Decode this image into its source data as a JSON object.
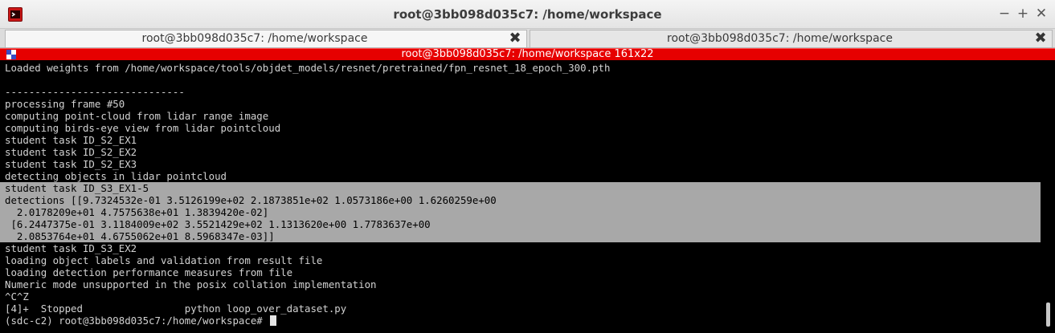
{
  "window": {
    "title": "root@3bb098d035c7: /home/workspace",
    "controls": {
      "minimize": "−",
      "maximize": "+",
      "close": "✕"
    },
    "icon": "terminator-icon"
  },
  "tabs": [
    {
      "label": "root@3bb098d035c7: /home/workspace",
      "close": "✖",
      "active": true
    },
    {
      "label": "root@3bb098d035c7: /home/workspace",
      "close": "✖",
      "active": false
    }
  ],
  "terminal": {
    "header": "root@3bb098d035c7: /home/workspace 161x22",
    "colors": {
      "header_bg": "#e60000",
      "selection_bg": "#a8a8a8",
      "text": "#d2d2d2",
      "background": "#000000"
    },
    "lines": [
      {
        "text": "Loaded weights from /home/workspace/tools/objdet_models/resnet/pretrained/fpn_resnet_18_epoch_300.pth",
        "selected": false
      },
      {
        "text": "",
        "selected": false
      },
      {
        "text": "------------------------------",
        "selected": false
      },
      {
        "text": "processing frame #50",
        "selected": false
      },
      {
        "text": "computing point-cloud from lidar range image",
        "selected": false
      },
      {
        "text": "computing birds-eye view from lidar pointcloud",
        "selected": false
      },
      {
        "text": "student task ID_S2_EX1",
        "selected": false
      },
      {
        "text": "student task ID_S2_EX2",
        "selected": false
      },
      {
        "text": "student task ID_S2_EX3",
        "selected": false
      },
      {
        "text": "detecting objects in lidar pointcloud",
        "selected": false
      },
      {
        "text": "student task ID_S3_EX1-5",
        "selected": true
      },
      {
        "text": "detections [[9.7324532e-01 3.5126199e+02 2.1873851e+02 1.0573186e+00 1.6260259e+00",
        "selected": true
      },
      {
        "text": "  2.0178209e+01 4.7575638e+01 1.3839420e-02]",
        "selected": true
      },
      {
        "text": " [6.2447375e-01 3.1184009e+02 3.5521429e+02 1.1313620e+00 1.7783637e+00",
        "selected": true
      },
      {
        "text": "  2.0853764e+01 4.6755062e+01 8.5968347e-03]]",
        "selected": true
      },
      {
        "text": "student task ID_S3_EX2",
        "selected": false
      },
      {
        "text": "loading object labels and validation from result file",
        "selected": false
      },
      {
        "text": "loading detection performance measures from file",
        "selected": false
      },
      {
        "text": "Numeric mode unsupported in the posix collation implementation",
        "selected": false
      },
      {
        "text": "^C^Z",
        "selected": false
      },
      {
        "text": "[4]+  Stopped                 python loop_over_dataset.py",
        "selected": false
      },
      {
        "text": "(sdc-c2) root@3bb098d035c7:/home/workspace# ",
        "selected": false,
        "prompt": true
      }
    ]
  }
}
